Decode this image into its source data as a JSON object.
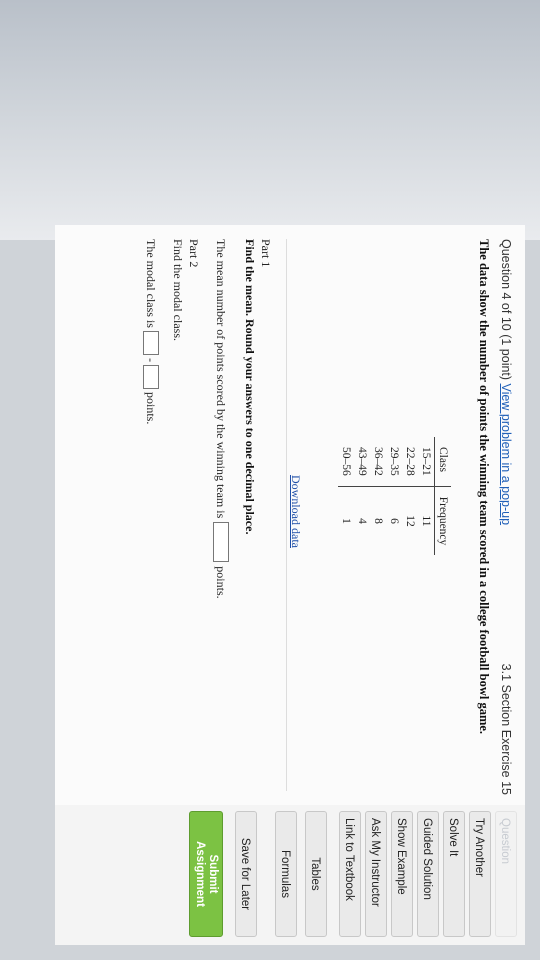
{
  "question": {
    "header": "Question 4 of 10 (1 point)",
    "popup_link": "View problem in a pop-up",
    "section": "3.1 Section Exercise 15",
    "prompt": "The data show the number of points the winning team scored in a college football bowl game."
  },
  "table": {
    "headers": [
      "Class",
      "Frequency"
    ],
    "rows": [
      [
        "15–21",
        "11"
      ],
      [
        "22–28",
        "12"
      ],
      [
        "29–35",
        "6"
      ],
      [
        "36–42",
        "8"
      ],
      [
        "43–49",
        "4"
      ],
      [
        "50–56",
        "1"
      ]
    ]
  },
  "download_label": "Download data",
  "part1": {
    "title": "Part 1",
    "instruction": "Find the mean. Round your answers to one decimal place.",
    "question_before": "The mean number of points scored by the winning team is",
    "question_after": "points.",
    "answer_value": ""
  },
  "part2": {
    "title": "Part 2",
    "instruction": "Find the modal class.",
    "question_before": "The modal class is",
    "separator": "-",
    "question_after": "points.",
    "answer_low": "",
    "answer_high": ""
  },
  "sidebar": {
    "question_label": "Question",
    "try_another": "Try Another",
    "solve_it": "Solve It",
    "guided_solution": "Guided Solution",
    "show_example": "Show Example",
    "ask_instructor": "Ask My Instructor",
    "link_textbook": "Link to Textbook",
    "tables": "Tables",
    "formulas": "Formulas",
    "save_later": "Save for Later",
    "submit_line1": "Submit",
    "submit_line2": "Assignment"
  }
}
